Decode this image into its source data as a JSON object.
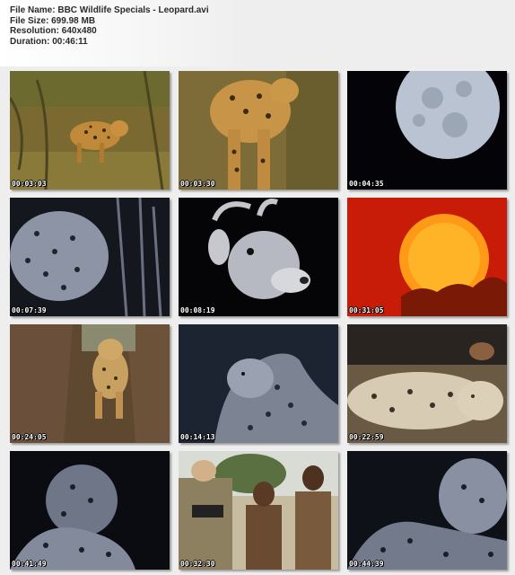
{
  "info": {
    "file_name": "File Name: BBC Wildlife Specials - Leopard.avi",
    "file_size": "File Size: 699.98 MB",
    "resolution": "Resolution: 640x480",
    "duration": "Duration: 00:46:11"
  },
  "thumbnails": [
    {
      "timestamp": "00:03:03"
    },
    {
      "timestamp": "00:03:30"
    },
    {
      "timestamp": "00:04:35"
    },
    {
      "timestamp": "00:07:39"
    },
    {
      "timestamp": "00:08:19"
    },
    {
      "timestamp": "00:31:05"
    },
    {
      "timestamp": "00:24:05"
    },
    {
      "timestamp": "00:14:13"
    },
    {
      "timestamp": "00:22:59"
    },
    {
      "timestamp": "00:41:49"
    },
    {
      "timestamp": "00:32:30"
    },
    {
      "timestamp": "00:44:39"
    }
  ]
}
